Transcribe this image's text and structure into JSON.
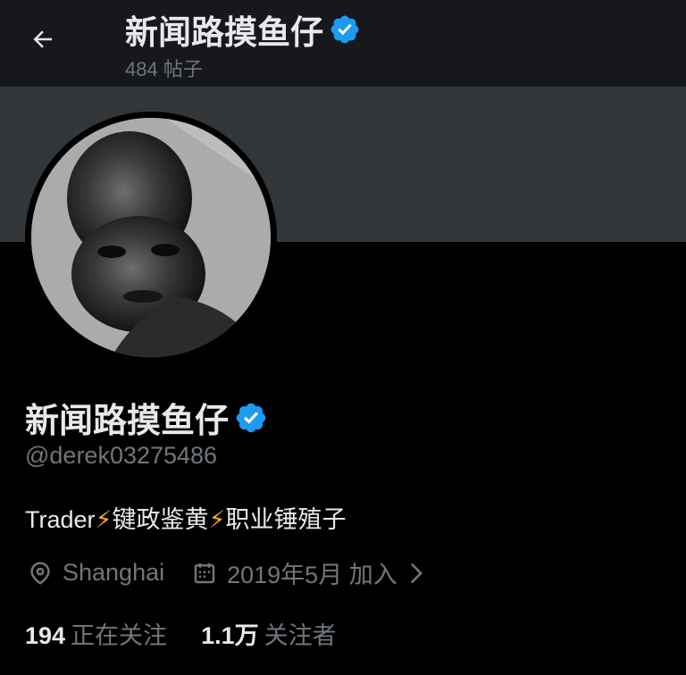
{
  "header": {
    "name": "新闻路摸鱼仔",
    "post_count": "484 帖子"
  },
  "profile": {
    "display_name": "新闻路摸鱼仔",
    "handle": "@derek03275486",
    "bio": {
      "part1": "Trader",
      "bolt": "⚡",
      "part2": "键政鉴黄",
      "part3": "职业锤殖子"
    },
    "location": "Shanghai",
    "joined": "2019年5月 加入",
    "following_count": "194",
    "following_label": "正在关注",
    "followers_count": "1.1万",
    "followers_label": "关注者"
  },
  "colors": {
    "verified": "#1d9bf0",
    "bolt": "#f5a623",
    "muted": "#71767b"
  },
  "icons": [
    "back-arrow-icon",
    "verified-badge-icon",
    "location-icon",
    "calendar-icon",
    "chevron-right-icon"
  ]
}
